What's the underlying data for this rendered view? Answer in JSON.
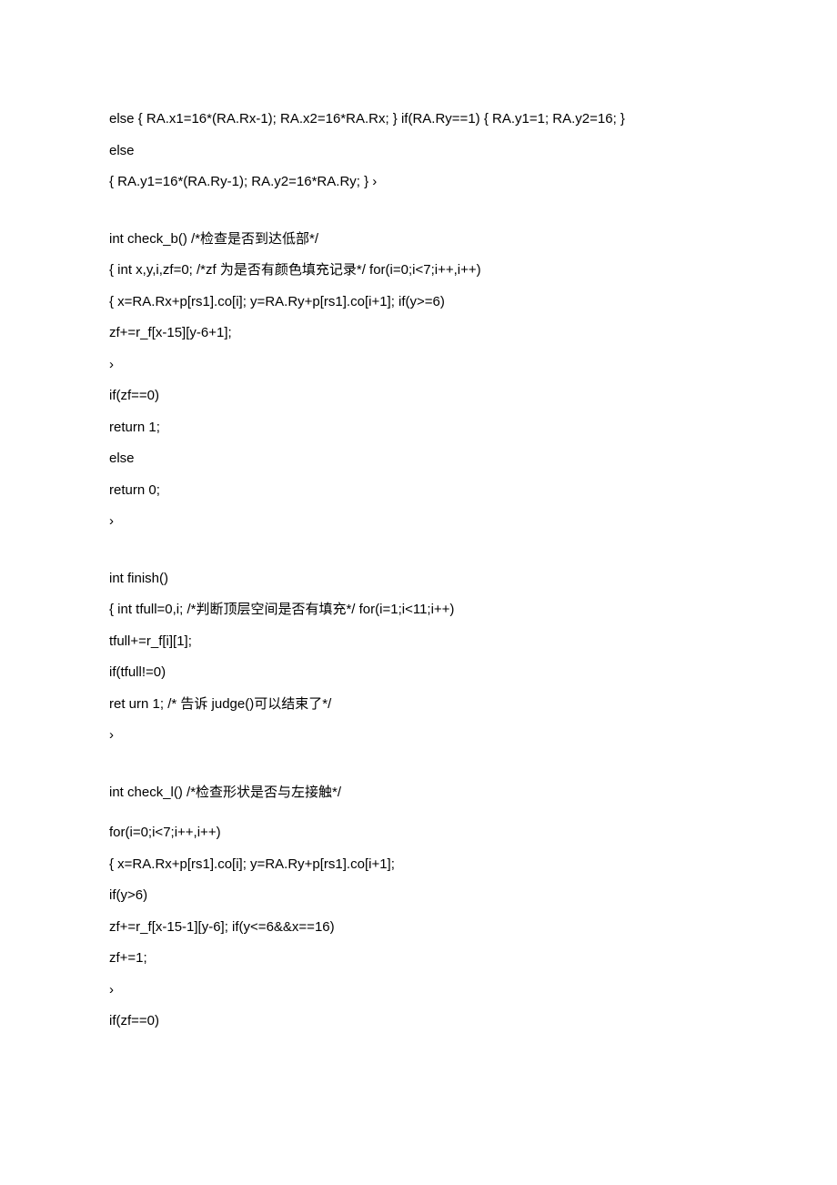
{
  "lines": [
    {
      "text": "else { RA.x1=16*(RA.Rx-1); RA.x2=16*RA.Rx; } if(RA.Ry==1) { RA.y1=1; RA.y2=16; }",
      "type": "code"
    },
    {
      "text": "else",
      "type": "code"
    },
    {
      "text": "{ RA.y1=16*(RA.Ry-1); RA.y2=16*RA.Ry; } ›",
      "type": "code"
    },
    {
      "text": "",
      "type": "gap"
    },
    {
      "text": "int check_b() /*检查是否到达低部*/",
      "type": "code"
    },
    {
      "text": "{ int x,y,i,zf=0; /*zf 为是否有颜色填充记录*/ for(i=0;i<7;i++,i++)",
      "type": "code"
    },
    {
      "text": "{ x=RA.Rx+p[rs1].co[i]; y=RA.Ry+p[rs1].co[i+1]; if(y>=6)",
      "type": "code"
    },
    {
      "text": "zf+=r_f[x-15][y-6+1];",
      "type": "code"
    },
    {
      "text": "›",
      "type": "code"
    },
    {
      "text": "if(zf==0)",
      "type": "code"
    },
    {
      "text": "return 1;",
      "type": "code"
    },
    {
      "text": "else",
      "type": "code"
    },
    {
      "text": "return 0;",
      "type": "code"
    },
    {
      "text": "›",
      "type": "code"
    },
    {
      "text": "",
      "type": "gap"
    },
    {
      "text": "int finish()",
      "type": "code"
    },
    {
      "text": "{ int tfull=0,i; /*判断顶层空间是否有填充*/ for(i=1;i<11;i++)",
      "type": "code"
    },
    {
      "text": "tfull+=r_f[i][1];",
      "type": "code"
    },
    {
      "text": "if(tfull!=0)",
      "type": "code"
    },
    {
      "text": "ret urn 1; /* 告诉 judge()可以结束了*/",
      "type": "code"
    },
    {
      "text": "›",
      "type": "code"
    },
    {
      "text": "",
      "type": "gap"
    },
    {
      "text": "int check_l() /*检查形状是否与左接触*/",
      "type": "code"
    },
    {
      "text": "",
      "type": "small-gap"
    },
    {
      "text": "for(i=0;i<7;i++,i++)",
      "type": "code"
    },
    {
      "text": "{ x=RA.Rx+p[rs1].co[i]; y=RA.Ry+p[rs1].co[i+1];",
      "type": "code"
    },
    {
      "text": "if(y>6)",
      "type": "code"
    },
    {
      "text": "zf+=r_f[x-15-1][y-6]; if(y<=6&&x==16)",
      "type": "code"
    },
    {
      "text": "zf+=1;",
      "type": "code"
    },
    {
      "text": "›",
      "type": "code"
    },
    {
      "text": "if(zf==0)",
      "type": "code"
    }
  ]
}
